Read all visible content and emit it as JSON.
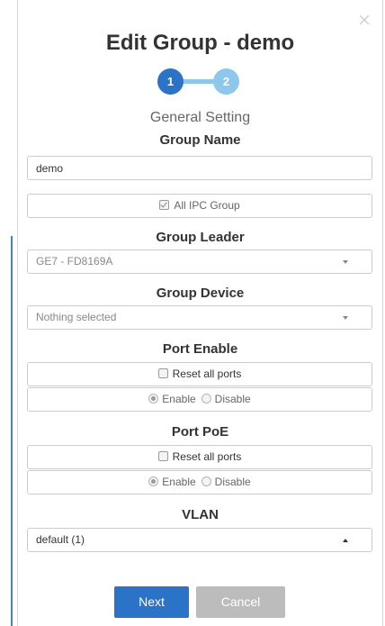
{
  "title": "Edit Group - demo",
  "stepper": {
    "step1": "1",
    "step2": "2",
    "current": 1
  },
  "subtitle": "General Setting",
  "group_name": {
    "label": "Group Name",
    "value": "demo"
  },
  "all_ipc": {
    "label": "All IPC Group",
    "checked": true
  },
  "group_leader": {
    "label": "Group Leader",
    "value": "GE7 - FD8169A"
  },
  "group_device": {
    "label": "Group Device",
    "value": "Nothing selected"
  },
  "port_enable": {
    "label": "Port Enable",
    "reset_label": "Reset all ports",
    "enable_label": "Enable",
    "disable_label": "Disable",
    "selected": "Enable"
  },
  "port_poe": {
    "label": "Port PoE",
    "reset_label": "Reset all ports",
    "enable_label": "Enable",
    "disable_label": "Disable",
    "selected": "Enable"
  },
  "vlan": {
    "label": "VLAN",
    "value": "default (1)"
  },
  "buttons": {
    "next": "Next",
    "cancel": "Cancel"
  },
  "colors": {
    "primary": "#2b73c8",
    "step_inactive": "#8cc7ee",
    "cancel": "#bcbcbc"
  },
  "icons": {
    "close": "close-icon",
    "caret": "caret-down-icon",
    "caret_up": "caret-up-icon"
  }
}
